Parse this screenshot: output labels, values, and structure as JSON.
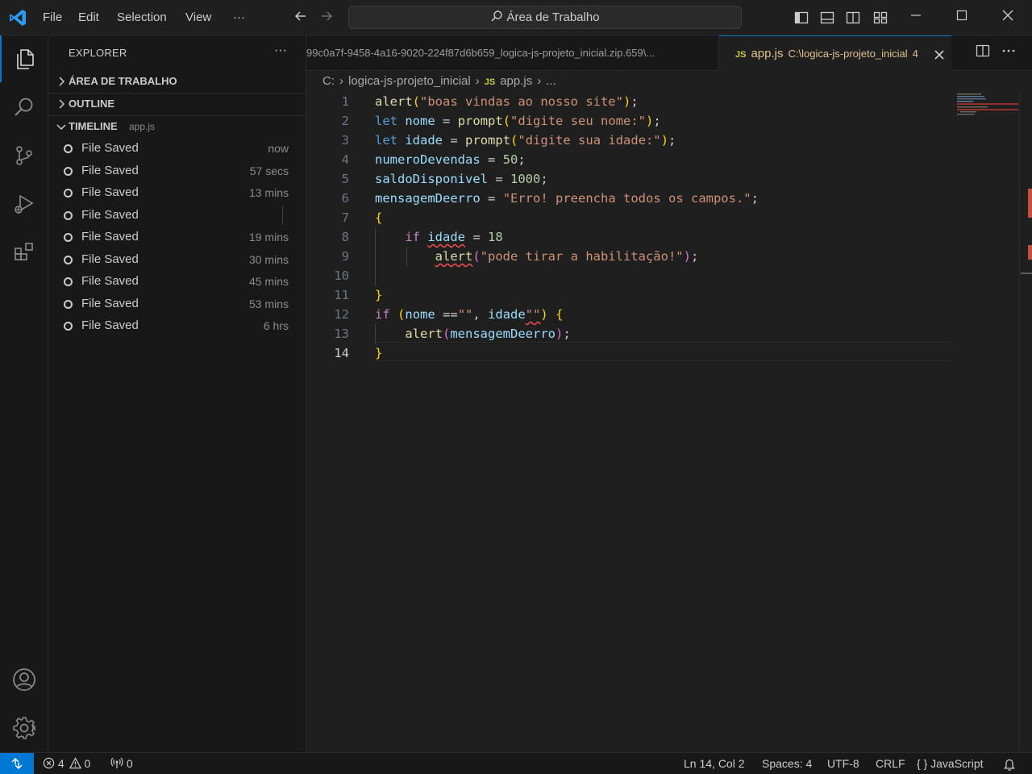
{
  "titlebar": {
    "menu": [
      "File",
      "Edit",
      "Selection",
      "View",
      "···"
    ],
    "search": "Área de Trabalho"
  },
  "sidebar": {
    "title": "EXPLORER",
    "more": "···",
    "sections": {
      "workspace": "ÁREA DE TRABALHO",
      "outline": "OUTLINE",
      "timeline": "TIMELINE",
      "timeline_file": "app.js"
    },
    "timeline": [
      {
        "label": "File Saved",
        "time": "now"
      },
      {
        "label": "File Saved",
        "time": "57 secs"
      },
      {
        "label": "File Saved",
        "time": "13 mins"
      },
      {
        "label": "File Saved",
        "time": ""
      },
      {
        "label": "File Saved",
        "time": "19 mins"
      },
      {
        "label": "File Saved",
        "time": "30 mins"
      },
      {
        "label": "File Saved",
        "time": "45 mins"
      },
      {
        "label": "File Saved",
        "time": "53 mins"
      },
      {
        "label": "File Saved",
        "time": "6 hrs"
      }
    ]
  },
  "tabs": {
    "inactive": "99c0a7f-9458-4a16-9020-224f87d6b659_logica-js-projeto_inicial.zip.659\\...",
    "active_icon": "JS",
    "active_name": "app.js",
    "active_path": "C:\\logica-js-projeto_inicial",
    "active_problems": "4"
  },
  "breadcrumb": {
    "drive": "C:",
    "folder": "logica-js-projeto_inicial",
    "icon": "JS",
    "file": "app.js",
    "more": "..."
  },
  "editor": {
    "current_line": 14,
    "lines": [
      "1",
      "2",
      "3",
      "4",
      "5",
      "6",
      "7",
      "8",
      "9",
      "10",
      "11",
      "12",
      "13",
      "14"
    ]
  },
  "statusbar": {
    "errors": "4",
    "warnings": "0",
    "ports": "0",
    "position": "Ln 14, Col 2",
    "spaces": "Spaces: 4",
    "encoding": "UTF-8",
    "eol": "CRLF",
    "language_icon": "{ }",
    "language": "JavaScript"
  },
  "colors": {
    "accent": "#0078d4",
    "error": "#f14c4c",
    "modified": "#e2c08d"
  }
}
